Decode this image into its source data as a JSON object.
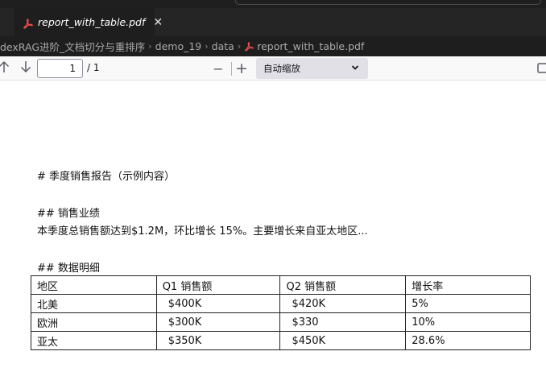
{
  "top_strip": {
    "left_text": "                             ",
    "right_text": ""
  },
  "tab": {
    "label": "report_with_table.pdf",
    "close": "✕"
  },
  "breadcrumb": {
    "items": [
      "dexRAG进阶_文档切分与重排序",
      "demo_19",
      "data",
      "report_with_table.pdf"
    ],
    "separator": "›"
  },
  "pdf_toolbar": {
    "page_number": "1",
    "page_count": "/ 1",
    "zoom_out": "−",
    "zoom_in": "+",
    "zoom_value": "自动缩放"
  },
  "document": {
    "heading1": "# 季度销售报告（示例内容）",
    "heading2": "## 销售业绩",
    "paragraph": "本季度总销售额达到$1.2M，环比增长 15%。主要增长来自亚太地区...",
    "heading3": "## 数据明细",
    "table": {
      "headers": [
        "地区",
        "Q1 销售额",
        "Q2 销售额",
        "增长率"
      ],
      "rows": [
        [
          "北美",
          "$400K",
          "$420K",
          "5%"
        ],
        [
          "欧洲",
          "$300K",
          "$330",
          "10%"
        ],
        [
          "亚太",
          "$350K",
          "$450K",
          "28.6%"
        ]
      ]
    }
  },
  "colors": {
    "tab_bar": "#252526",
    "editor_bg": "#1e1e1e",
    "pdf_icon": "#f14c4c",
    "toolbar_bg": "#f9f9fa"
  }
}
